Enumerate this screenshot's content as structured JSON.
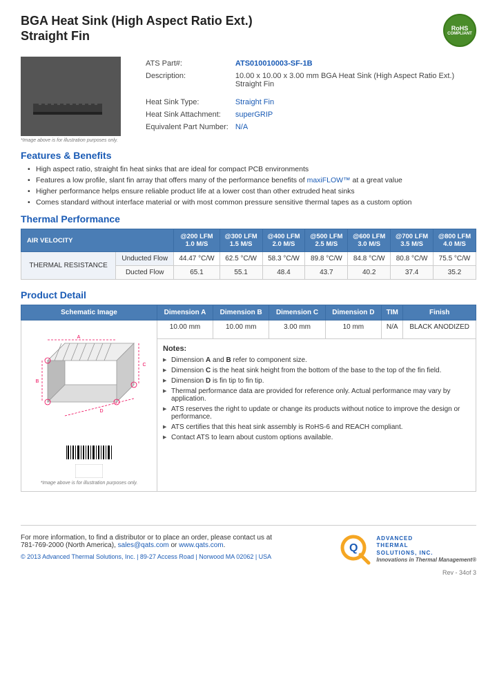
{
  "header": {
    "title_line1": "BGA Heat Sink (High Aspect Ratio Ext.)",
    "title_line2": "Straight Fin",
    "rohs_line1": "RoHS",
    "rohs_line2": "COMPLIANT"
  },
  "specs": {
    "part_label": "ATS Part#:",
    "part_number": "ATS010010003-SF-1B",
    "description_label": "Description:",
    "description": "10.00 x 10.00 x 3.00 mm  BGA Heat Sink (High Aspect Ratio Ext.) Straight Fin",
    "heat_sink_type_label": "Heat Sink Type:",
    "heat_sink_type": "Straight Fin",
    "heat_sink_attachment_label": "Heat Sink Attachment:",
    "heat_sink_attachment": "superGRIP",
    "equiv_part_label": "Equivalent Part Number:",
    "equiv_part": "N/A"
  },
  "image_caption": "*Image above is for illustration purposes only.",
  "features": {
    "heading": "Features & Benefits",
    "items": [
      "High aspect ratio, straight fin heat sinks that are ideal for compact PCB environments",
      "Features a low profile, slant fin array that offers many of the performance benefits of maxiFLOW™ at a great value",
      "Higher performance helps ensure reliable product life at a lower cost than other extruded heat sinks",
      "Comes standard without interface material or with most common pressure sensitive thermal tapes as a custom option"
    ]
  },
  "thermal_performance": {
    "heading": "Thermal Performance",
    "col_headers": [
      "AIR VELOCITY",
      "@200 LFM\n1.0 M/S",
      "@300 LFM\n1.5 M/S",
      "@400 LFM\n2.0 M/S",
      "@500 LFM\n2.5 M/S",
      "@600 LFM\n3.0 M/S",
      "@700 LFM\n3.5 M/S",
      "@800 LFM\n4.0 M/S"
    ],
    "row_header": "THERMAL RESISTANCE",
    "rows": [
      {
        "label": "Unducted Flow",
        "values": [
          "44.47 °C/W",
          "62.5 °C/W",
          "58.3 °C/W",
          "89.8 °C/W",
          "84.8 °C/W",
          "80.8 °C/W",
          "75.5 °C/W"
        ]
      },
      {
        "label": "Ducted Flow",
        "values": [
          "65.1",
          "55.1",
          "48.4",
          "43.7",
          "40.2",
          "37.4",
          "35.2"
        ]
      }
    ]
  },
  "product_detail": {
    "heading": "Product Detail",
    "table_headers": [
      "Schematic Image",
      "Dimension A",
      "Dimension B",
      "Dimension C",
      "Dimension D",
      "TIM",
      "Finish"
    ],
    "dimensions": {
      "dim_a": "10.00 mm",
      "dim_b": "10.00 mm",
      "dim_c": "3.00 mm",
      "dim_d": "10 mm",
      "tim": "N/A",
      "finish": "BLACK ANODIZED"
    },
    "notes_label": "Notes:",
    "notes": [
      "Dimension A and B refer to component size.",
      "Dimension C is the heat sink height from the bottom of the base to the top of the fin field.",
      "Dimension D is fin tip to fin tip.",
      "Thermal performance data are provided for reference only. Actual performance may vary by application.",
      "ATS reserves the right to update or change its products without notice to improve the design or performance.",
      "ATS certifies that this heat sink assembly is RoHS-6 and REACH compliant.",
      "Contact ATS to learn about custom options available."
    ],
    "schematic_caption": "*Image above is for illustration purposes only."
  },
  "footer": {
    "contact_text": "For more information, to find a distributor or to place an order, please contact us at",
    "phone": "781-769-2000 (North America),",
    "email": "sales@qats.com",
    "email_connector": " or ",
    "website": "www.qats.com",
    "copyright": "© 2013 Advanced Thermal Solutions, Inc. | 89-27 Access Road  |  Norwood MA  02062  |  USA",
    "ats_name_line1": "ADVANCED",
    "ats_name_line2": "THERMAL",
    "ats_name_line3": "SOLUTIONS, INC.",
    "tagline": "Innovations in Thermal Management®",
    "rev": "Rev - 34of 3"
  }
}
